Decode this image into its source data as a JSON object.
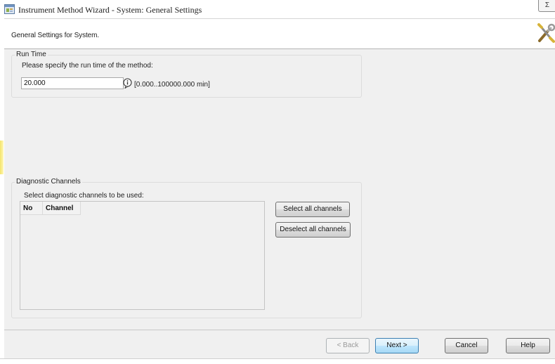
{
  "window": {
    "title": "Instrument Method Wizard - System: General Settings",
    "close_glyph": "Σ"
  },
  "header": {
    "text": "General Settings for System.",
    "icon": "wrench-screwdriver-icon"
  },
  "run_time": {
    "group_label": "Run Time",
    "prompt": "Please specify the run time of the method:",
    "value": "20.000",
    "range": "[0.000..100000.000 min]"
  },
  "diagnostic": {
    "group_label": "Diagnostic Channels",
    "prompt": "Select diagnostic channels to be used:",
    "columns": [
      "No",
      "Channel"
    ],
    "rows": [],
    "select_all_label": "Select all channels",
    "deselect_all_label": "Deselect all channels"
  },
  "footer": {
    "back_label": "< Back",
    "next_label": "Next >",
    "cancel_label": "Cancel",
    "help_label": "Help"
  },
  "colors": {
    "panel": "#f0f0f0",
    "header_bg": "#ffffff",
    "default_button_border": "#3c7fb1"
  }
}
